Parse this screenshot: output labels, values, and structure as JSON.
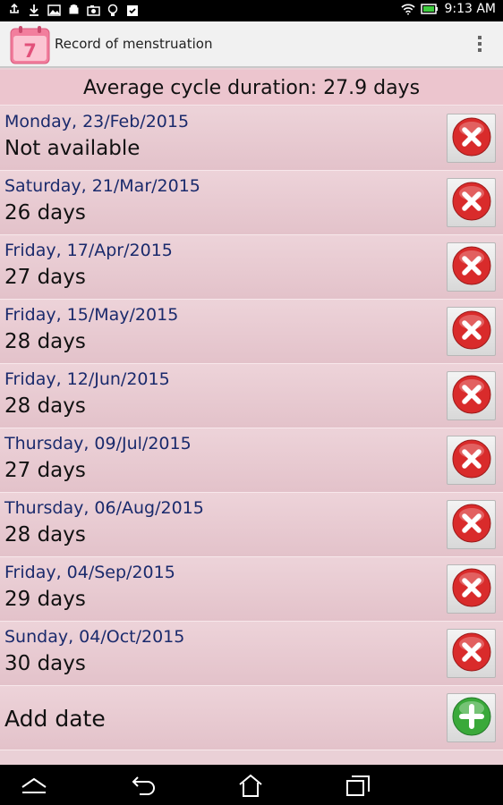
{
  "status_bar": {
    "time": "9:13 AM",
    "icons_left": [
      "usb-icon",
      "download-icon",
      "image-icon",
      "android-icon",
      "camera-icon",
      "bulb-icon",
      "clipboard-icon"
    ],
    "icons_right": [
      "wifi-icon",
      "battery-icon"
    ]
  },
  "app_bar": {
    "title": "Record of menstruation",
    "icon_number": "7"
  },
  "summary": {
    "text": "Average cycle duration: 27.9 days"
  },
  "records": [
    {
      "date": "Monday, 23/Feb/2015",
      "duration": "Not available"
    },
    {
      "date": "Saturday, 21/Mar/2015",
      "duration": "26 days"
    },
    {
      "date": "Friday, 17/Apr/2015",
      "duration": "27 days"
    },
    {
      "date": "Friday, 15/May/2015",
      "duration": "28 days"
    },
    {
      "date": "Friday, 12/Jun/2015",
      "duration": "28 days"
    },
    {
      "date": "Thursday, 09/Jul/2015",
      "duration": "27 days"
    },
    {
      "date": "Thursday, 06/Aug/2015",
      "duration": "28 days"
    },
    {
      "date": "Friday, 04/Sep/2015",
      "duration": "29 days"
    },
    {
      "date": "Sunday, 04/Oct/2015",
      "duration": "30 days"
    }
  ],
  "add": {
    "label": "Add date"
  },
  "colors": {
    "delete": "#d92b2b",
    "add": "#3aa93a",
    "row": "#e8cbd2",
    "header": "#ecc5ce",
    "date_text": "#1a2a6c"
  }
}
